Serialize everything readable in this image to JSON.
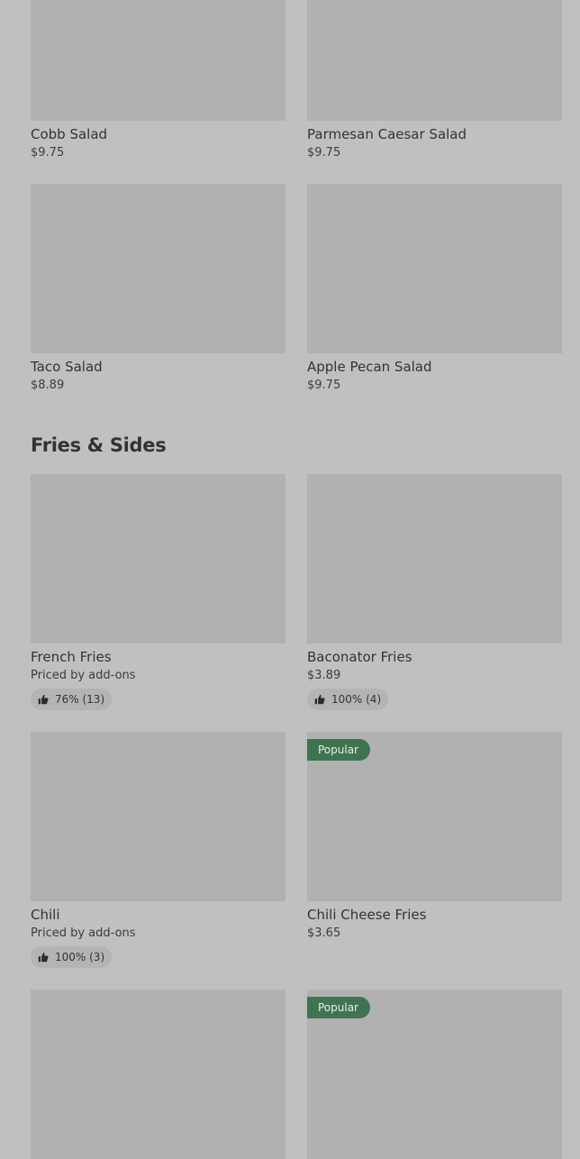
{
  "salads": {
    "items": [
      {
        "name": "Cobb Salad",
        "price": "$9.75"
      },
      {
        "name": "Parmesan Caesar Salad",
        "price": "$9.75"
      },
      {
        "name": "Taco Salad",
        "price": "$8.89"
      },
      {
        "name": "Apple Pecan Salad",
        "price": "$9.75"
      }
    ]
  },
  "fries_sides": {
    "title": "Fries & Sides",
    "items": [
      {
        "name": "French Fries",
        "price": "Priced by add-ons",
        "rating": "76% (13)"
      },
      {
        "name": "Baconator Fries",
        "price": "$3.89",
        "rating": "100% (4)"
      },
      {
        "name": "Chili",
        "price": "Priced by add-ons",
        "rating": "100% (3)"
      },
      {
        "name": "Chili Cheese Fries",
        "price": "$3.65",
        "badge": "Popular"
      },
      {
        "name": "",
        "price": ""
      },
      {
        "name": "",
        "price": "",
        "badge": "Popular"
      }
    ]
  },
  "icons": {
    "rating_icon": "thumbs-up-icon"
  },
  "colors": {
    "background": "#c0c0c0",
    "image_placeholder": "#b1b1b1",
    "popular_badge": "#3f7451",
    "rating_pill": "#b4b4b4",
    "text": "#333333"
  }
}
